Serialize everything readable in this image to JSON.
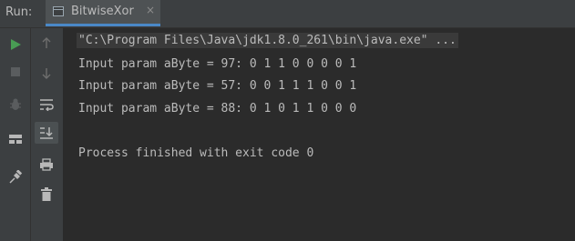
{
  "header": {
    "run_label": "Run:",
    "tab_title": "BitwiseXor",
    "close_glyph": "×"
  },
  "console": {
    "command": "\"C:\\Program Files\\Java\\jdk1.8.0_261\\bin\\java.exe\" ...",
    "lines": [
      "Input param aByte = 97: 0 1 1 0 0 0 0 1",
      "Input param aByte = 57: 0 0 1 1 1 0 0 1",
      "Input param aByte = 88: 0 1 0 1 1 0 0 0"
    ],
    "exit_message": "Process finished with exit code 0"
  },
  "colors": {
    "run_green": "#499c54",
    "accent_blue": "#4a88c7"
  }
}
